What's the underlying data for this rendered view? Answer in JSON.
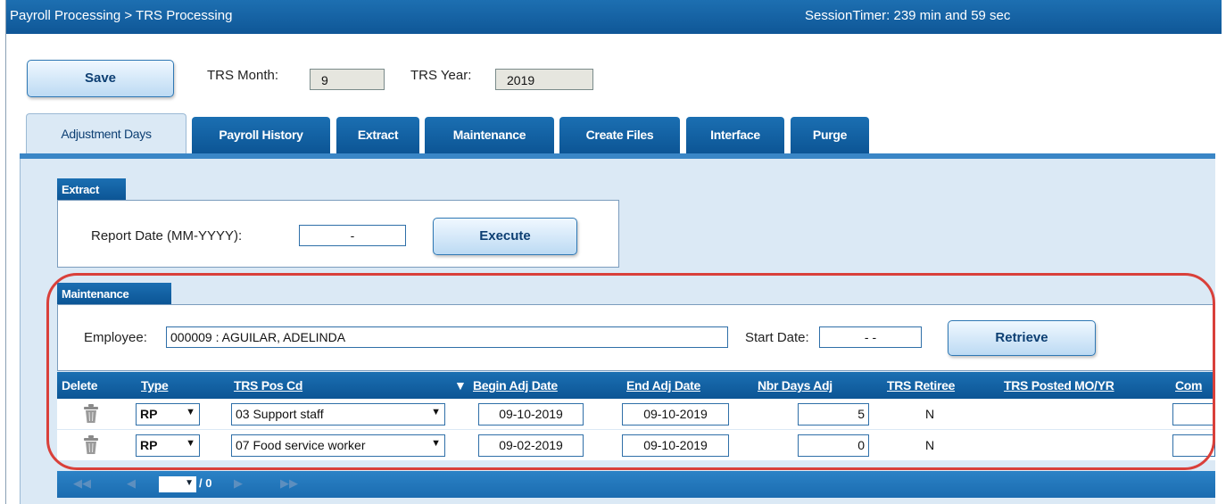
{
  "header": {
    "breadcrumb": "Payroll Processing > TRS Processing",
    "session_timer": "SessionTimer: 239 min and 59 sec"
  },
  "toolbar": {
    "save_label": "Save",
    "trs_month_label": "TRS Month:",
    "trs_month_value": "9",
    "trs_year_label": "TRS Year:",
    "trs_year_value": "2019"
  },
  "tabs": [
    {
      "label": "Adjustment Days",
      "active": true
    },
    {
      "label": "Payroll History"
    },
    {
      "label": "Extract"
    },
    {
      "label": "Maintenance"
    },
    {
      "label": "Create Files"
    },
    {
      "label": "Interface"
    },
    {
      "label": "Purge"
    }
  ],
  "extract": {
    "title": "Extract",
    "report_date_label": "Report Date (MM-YYYY):",
    "report_date_value": "-",
    "execute_label": "Execute"
  },
  "maintenance": {
    "title": "Maintenance",
    "employee_label": "Employee:",
    "employee_value": "000009 : AGUILAR, ADELINDA",
    "start_date_label": "Start Date:",
    "start_date_value": "- -",
    "retrieve_label": "Retrieve"
  },
  "grid": {
    "columns": [
      "Delete",
      "Type",
      "TRS Pos Cd",
      "Begin Adj Date",
      "End Adj Date",
      "Nbr Days Adj",
      "TRS Retiree",
      "TRS Posted MO/YR",
      "Com"
    ],
    "sort_indicator": "▼",
    "rows": [
      {
        "type": "RP",
        "pos_cd": "03 Support staff",
        "begin": "09-10-2019",
        "end": "09-10-2019",
        "days": "5",
        "retiree": "N"
      },
      {
        "type": "RP",
        "pos_cd": "07 Food service worker",
        "begin": "09-02-2019",
        "end": "09-10-2019",
        "days": "0",
        "retiree": "N"
      }
    ]
  },
  "pager": {
    "first": "◀◀",
    "prev": "◀",
    "page_value": "▼",
    "page_count": "/ 0",
    "next": "▶",
    "last": "▶▶"
  },
  "icons": {
    "trash": "trash-icon",
    "dropdown": "chevron-down-icon"
  },
  "colors": {
    "accent": "#0f5797",
    "highlight_outline": "#d9403a"
  }
}
